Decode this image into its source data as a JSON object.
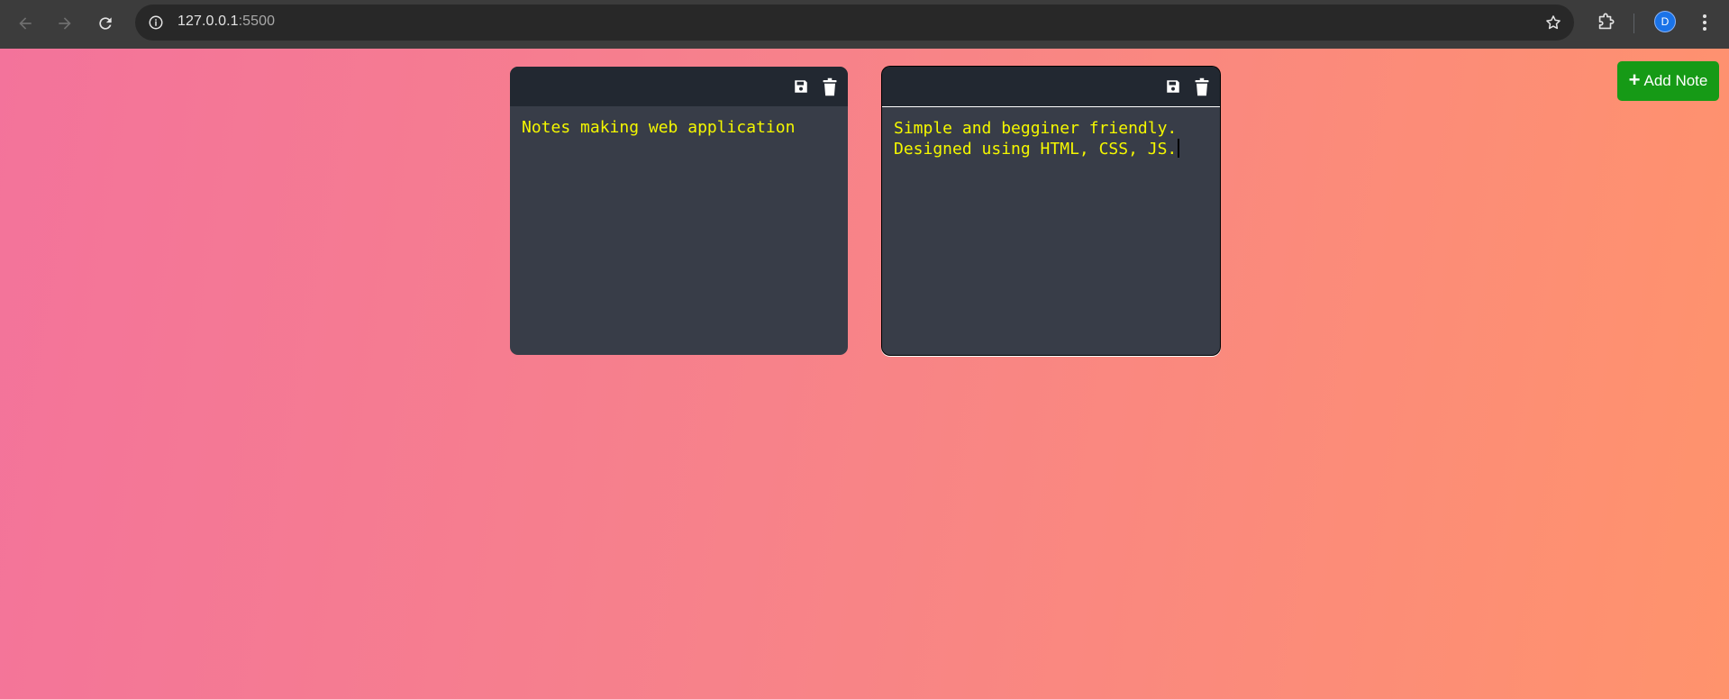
{
  "browser": {
    "url_host": "127.0.0.1",
    "url_port": ":5500",
    "profile_initial": "D",
    "icons": {
      "back": "arrow-left-icon",
      "forward": "arrow-right-icon",
      "reload": "reload-icon",
      "site_info": "info-icon",
      "bookmark": "star-icon",
      "extensions": "puzzle-icon",
      "menu": "kebab-menu-icon"
    }
  },
  "app": {
    "add_note_label": "Add Note",
    "add_note_icon": "plus-icon",
    "add_note_color": "#169a16",
    "note_text_color": "#f4f700",
    "note_bg": "#383d48",
    "toolbar_bg": "#222831",
    "notes": [
      {
        "text": "Notes making web application"
      },
      {
        "text": "Simple and begginer friendly.\nDesigned using HTML, CSS, JS."
      }
    ]
  }
}
